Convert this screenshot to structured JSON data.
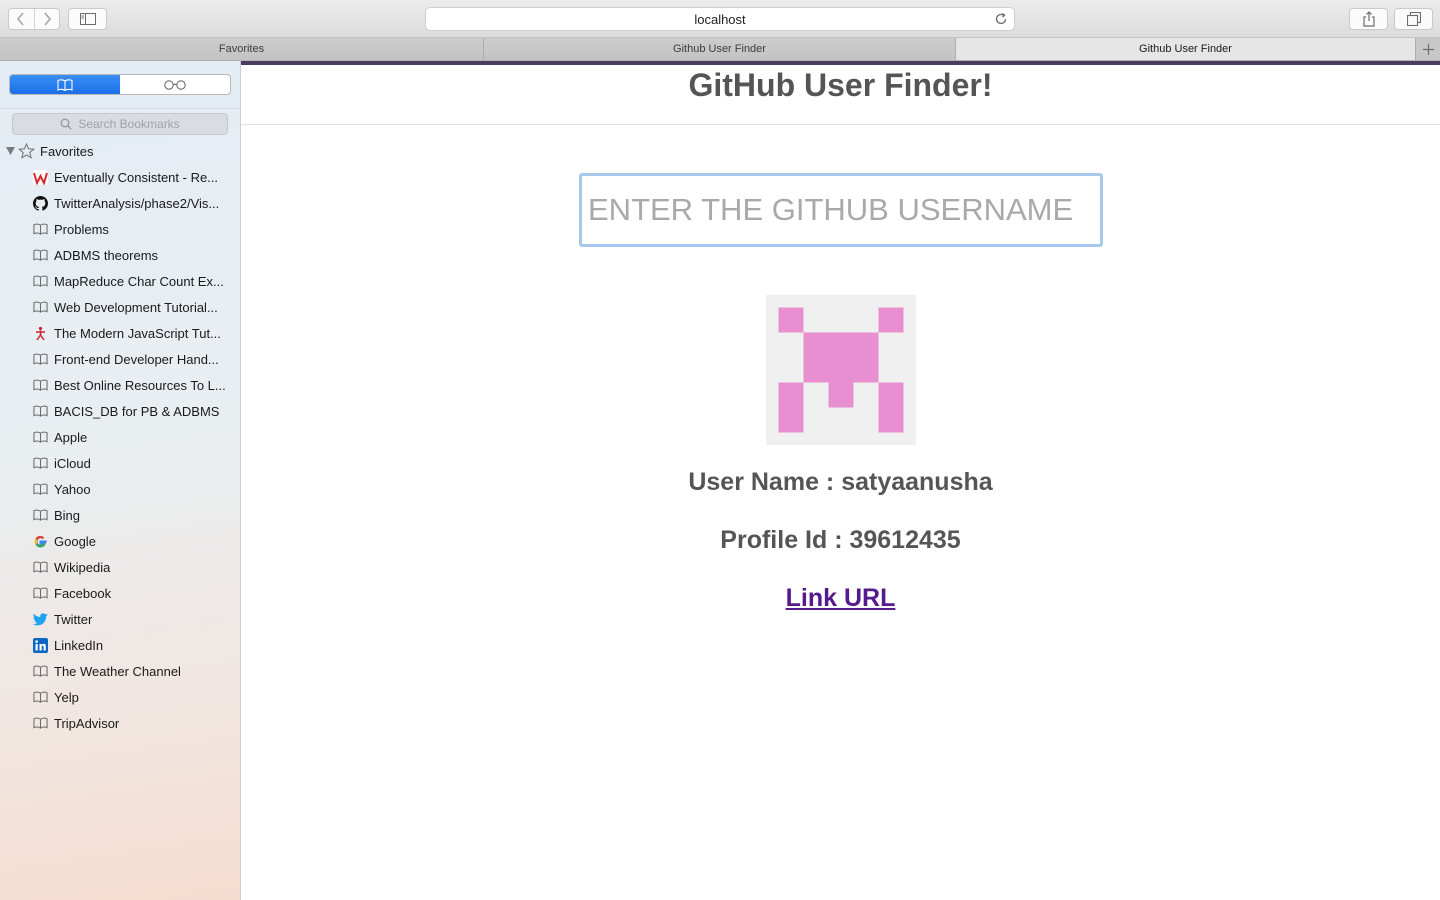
{
  "browser": {
    "address": "localhost",
    "icons": {
      "back": "chevron-left-icon",
      "forward": "chevron-right-icon",
      "sidebar": "sidebar-icon",
      "reload": "reload-icon",
      "share": "share-icon",
      "tabs": "tab-overview-icon",
      "new_tab": "plus-icon"
    }
  },
  "tabs": [
    {
      "label": "Favorites",
      "active": false
    },
    {
      "label": "Github User Finder",
      "active": false
    },
    {
      "label": "Github User Finder",
      "active": true
    }
  ],
  "sidebar": {
    "search_placeholder": "Search Bookmarks",
    "favorites_label": "Favorites",
    "bookmarks": [
      {
        "label": "Eventually Consistent - Re...",
        "icon": "w-brand-icon"
      },
      {
        "label": "TwitterAnalysis/phase2/Vis...",
        "icon": "github-icon"
      },
      {
        "label": "Problems",
        "icon": "book-icon"
      },
      {
        "label": "ADBMS theorems",
        "icon": "book-icon"
      },
      {
        "label": "MapReduce Char Count Ex...",
        "icon": "book-icon"
      },
      {
        "label": "Web Development Tutorial...",
        "icon": "book-icon"
      },
      {
        "label": "The Modern JavaScript Tut...",
        "icon": "js-tutorial-icon"
      },
      {
        "label": "Front-end Developer Hand...",
        "icon": "book-icon"
      },
      {
        "label": "Best Online Resources To L...",
        "icon": "book-icon"
      },
      {
        "label": "BACIS_DB for PB & ADBMS",
        "icon": "book-icon"
      },
      {
        "label": "Apple",
        "icon": "book-icon"
      },
      {
        "label": "iCloud",
        "icon": "book-icon"
      },
      {
        "label": "Yahoo",
        "icon": "book-icon"
      },
      {
        "label": "Bing",
        "icon": "book-icon"
      },
      {
        "label": "Google",
        "icon": "google-icon"
      },
      {
        "label": "Wikipedia",
        "icon": "book-icon"
      },
      {
        "label": "Facebook",
        "icon": "book-icon"
      },
      {
        "label": "Twitter",
        "icon": "twitter-icon"
      },
      {
        "label": "LinkedIn",
        "icon": "linkedin-icon"
      },
      {
        "label": "The Weather Channel",
        "icon": "book-icon"
      },
      {
        "label": "Yelp",
        "icon": "book-icon"
      },
      {
        "label": "TripAdvisor",
        "icon": "book-icon"
      }
    ]
  },
  "page": {
    "title": "GitHub User Finder!",
    "input_placeholder": "ENTER THE GITHUB USERNAME",
    "input_value": "",
    "user_name_text": "User Name : satyaanusha",
    "profile_id_text": "Profile Id : 39612435",
    "link_text": "Link URL"
  },
  "colors": {
    "accent_blue": "#1a6fe8",
    "heading_gray": "#555555",
    "link_purple": "#551a8b",
    "avatar_pink": "#e78fd0",
    "avatar_bg": "#f0f0f0",
    "tab_strip_purple": "#4d3b63"
  }
}
